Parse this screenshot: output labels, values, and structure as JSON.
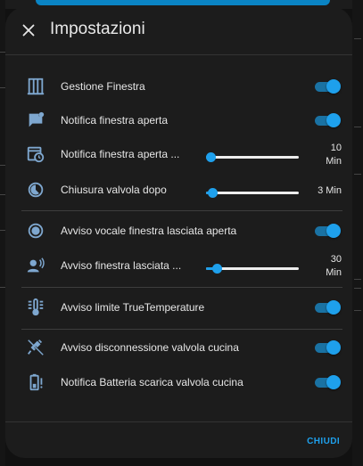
{
  "dialog": {
    "title": "Impostazioni",
    "close_icon": "close-icon",
    "footer_button": "CHIUDI"
  },
  "colors": {
    "accent": "#1ea0ec",
    "icon": "#7ea7cf",
    "surface": "#1c1c1c",
    "text": "#e6e6e6"
  },
  "rows": [
    {
      "label": "Gestione Finestra",
      "icon": "window-icon",
      "control": "toggle",
      "on": true
    },
    {
      "label": "Notifica finestra aperta",
      "icon": "message-alert-icon",
      "control": "toggle",
      "on": true
    },
    {
      "label": "Notifica finestra aperta ...",
      "icon": "calendar-clock-icon",
      "control": "slider",
      "value_line1": "10",
      "value_line2": "Min",
      "level": 0.05
    },
    {
      "label": "Chiusura valvola dopo",
      "icon": "timer-icon",
      "control": "slider",
      "value": "3 Min",
      "level": 0.07
    },
    {
      "label": "Avviso vocale finestra lasciata aperta",
      "icon": "record-icon",
      "control": "toggle",
      "on": true
    },
    {
      "label": "Avviso finestra lasciata ...",
      "icon": "account-voice-icon",
      "control": "slider",
      "value_line1": "30",
      "value_line2": "Min",
      "level": 0.12
    },
    {
      "label": "Avviso limite TrueTemperature",
      "icon": "thermometer-lines-icon",
      "control": "toggle",
      "on": true
    },
    {
      "label": "Avviso disconnessione valvola cucina",
      "icon": "power-plug-off-icon",
      "control": "toggle",
      "on": true
    },
    {
      "label": "Notifica Batteria scarica valvola cucina",
      "icon": "battery-alert-icon",
      "control": "toggle",
      "on": true
    }
  ]
}
